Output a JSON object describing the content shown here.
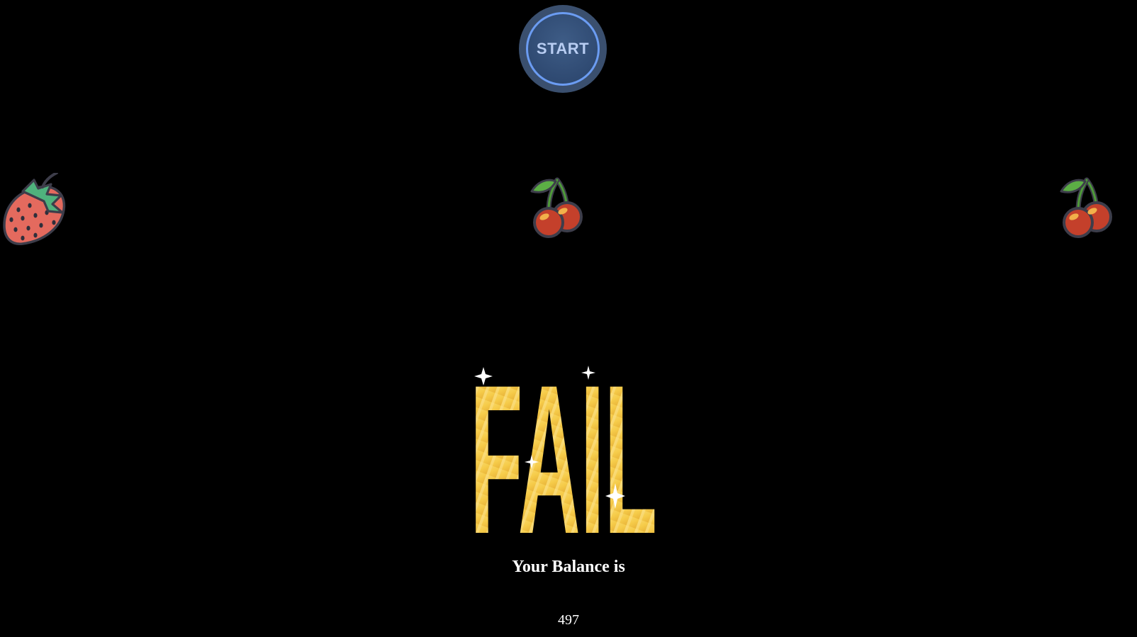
{
  "start_button": {
    "label": "START",
    "ring_color": "#6b9cf2",
    "fill_color": "#3a4f6e"
  },
  "reels": [
    {
      "symbol": "strawberry-icon"
    },
    {
      "symbol": "cherry-icon"
    },
    {
      "symbol": "cherry-icon"
    }
  ],
  "result": {
    "text": "FAIL",
    "color": "#f6cc4a"
  },
  "balance": {
    "label": "Your Balance is",
    "value": "497"
  }
}
